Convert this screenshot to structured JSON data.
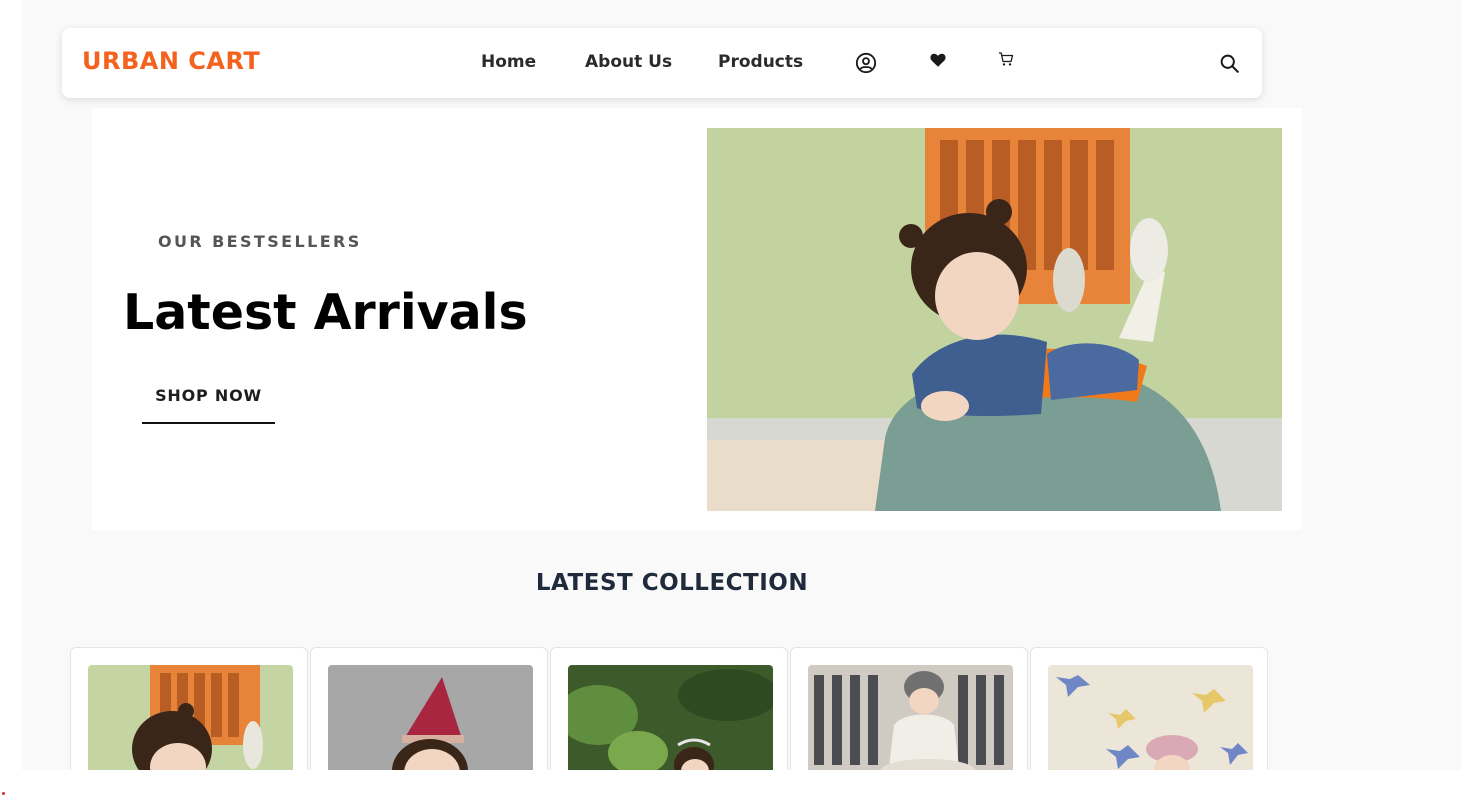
{
  "navbar": {
    "logo": "URBAN CART",
    "links": [
      "Home",
      "About Us",
      "Products"
    ],
    "icons": [
      "user-circle-icon",
      "heart-icon",
      "cart-icon",
      "search-icon"
    ]
  },
  "hero": {
    "kicker": "OUR BESTSELLERS",
    "title": "Latest Arrivals",
    "cta": "SHOP NOW"
  },
  "collection": {
    "title": "LATEST COLLECTION",
    "products": [
      {
        "image": "girl-on-green-seat"
      },
      {
        "image": "child-red-party-hat"
      },
      {
        "image": "girl-in-plants"
      },
      {
        "image": "boy-sitting-city"
      },
      {
        "image": "girl-with-pinwheels"
      }
    ]
  },
  "colors": {
    "brand": "#f4621f",
    "page_bg": "#f9f9f9",
    "heading": "#1f2a3a"
  }
}
